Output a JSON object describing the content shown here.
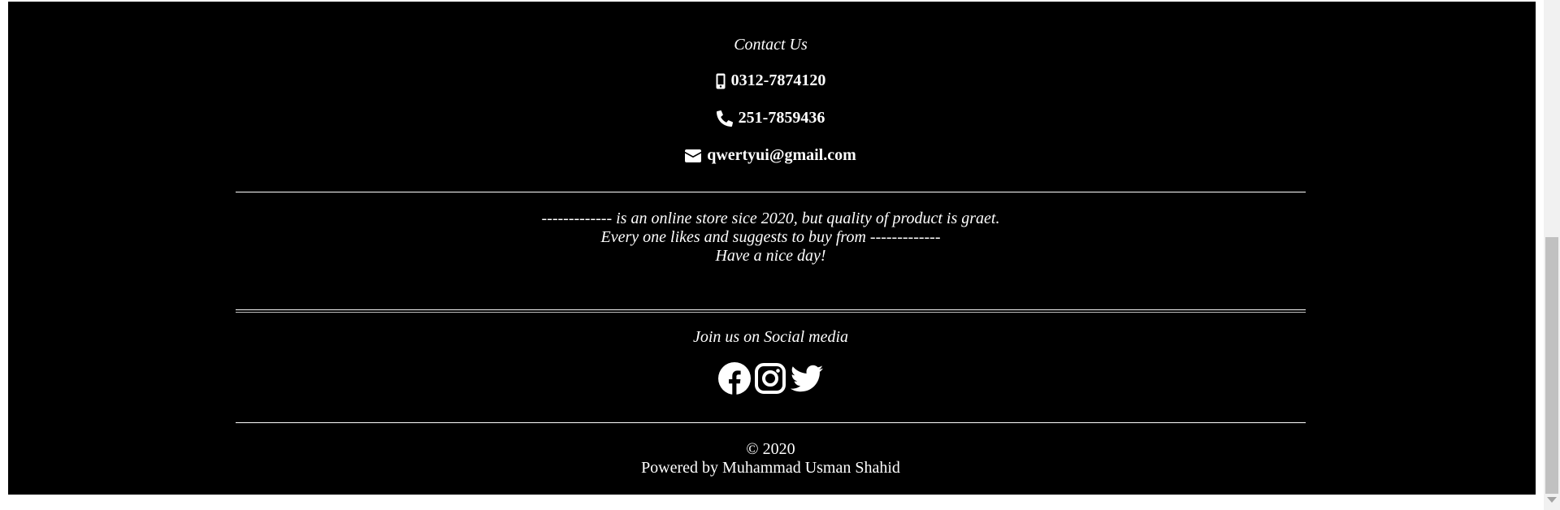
{
  "contact": {
    "title": "Contact Us",
    "mobile": "0312-7874120",
    "phone": "251-7859436",
    "email": "qwertyui@gmail.com"
  },
  "about": {
    "line1": "------------- is an online store sice 2020, but quality of product is graet.",
    "line2": "Every one likes and suggests to buy from -------------",
    "line3": "Have a nice day!"
  },
  "social": {
    "title": "Join us on Social media",
    "icons": [
      "facebook-icon",
      "instagram-icon",
      "twitter-icon"
    ]
  },
  "copyright": {
    "year": "© 2020",
    "powered": "Powered by Muhammad Usman Shahid"
  },
  "colors": {
    "footer_bg": "#000000",
    "text": "#ffffff"
  }
}
